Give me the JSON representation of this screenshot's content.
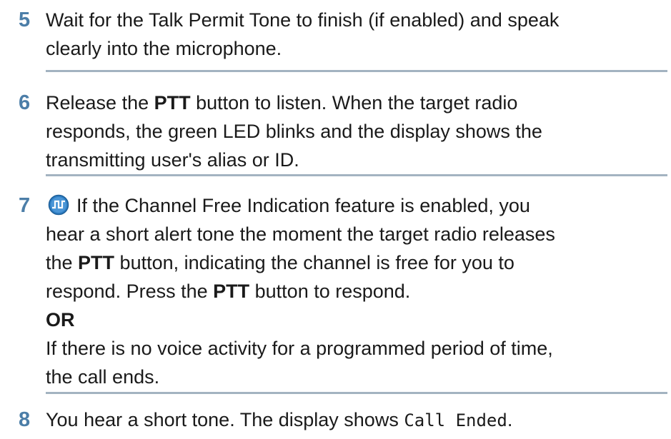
{
  "steps": [
    {
      "number": "5",
      "lines": [
        "Wait for the Talk Permit Tone to finish (if enabled) and speak",
        "clearly into the microphone."
      ]
    },
    {
      "number": "6",
      "line1_a": "Release the ",
      "line1_bold": "PTT",
      "line1_b": " button to listen. When the target radio",
      "line2": "responds, the green LED blinks and the display shows the",
      "line3": "transmitting user's alias or ID."
    },
    {
      "number": "7",
      "icon": "channel-free-indication-icon",
      "line1": "If the Channel Free Indication feature is enabled, you",
      "line2": "hear a short alert tone the moment the target radio releases",
      "line3_a": "the ",
      "line3_bold": "PTT",
      "line3_b": " button, indicating the channel is free for you to",
      "line4_a": "respond. Press the ",
      "line4_bold": "PTT",
      "line4_b": " button to respond.",
      "or_label": "OR",
      "line5": "If there is no voice activity for a programmed period of time,",
      "line6": "the call ends."
    },
    {
      "number": "8",
      "text": "You hear a short tone. The display shows ",
      "display_text": "Call Ended",
      "text_end": "."
    }
  ],
  "colors": {
    "step_number": "#4c7ea8",
    "divider": "#a3b3c1",
    "icon_fill": "#2f7fc4",
    "body_text": "#1a1a1a"
  }
}
